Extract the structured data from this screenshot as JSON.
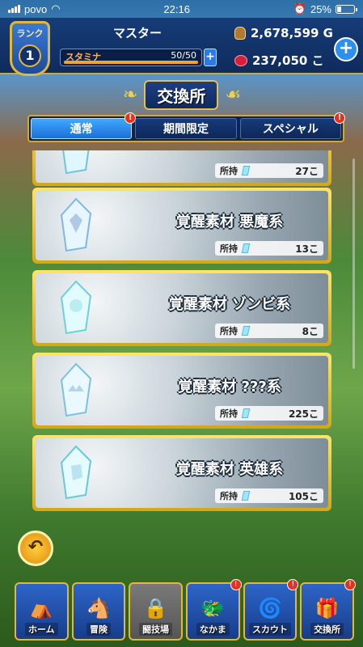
{
  "status_bar": {
    "carrier": "povo",
    "time": "22:16",
    "battery": "25%",
    "battery_level": 0.25
  },
  "header": {
    "rank_label": "ランク",
    "rank_value": "1",
    "player_name": "マスター",
    "stamina_label": "スタミナ",
    "stamina_text": "50/50",
    "stamina_fraction": 1.0,
    "gold": "2,678,599 G",
    "gems": "237,050 こ"
  },
  "title": "交換所",
  "tabs": [
    {
      "label": "通常",
      "active": true,
      "alert": "!"
    },
    {
      "label": "期間限定",
      "active": false,
      "alert": ""
    },
    {
      "label": "スペシャル",
      "active": false,
      "alert": "!"
    }
  ],
  "owned_label": "所持",
  "items": [
    {
      "name": "",
      "count": "27こ"
    },
    {
      "name": "覚醒素材 悪魔系",
      "count": "13こ"
    },
    {
      "name": "覚醒素材 ゾンビ系",
      "count": "8こ"
    },
    {
      "name": "覚醒素材 ???系",
      "count": "225こ"
    },
    {
      "name": "覚醒素材 英雄系",
      "count": "105こ"
    }
  ],
  "bottom_nav": [
    {
      "label": "ホーム",
      "icon": "tent-icon",
      "glyph": "⛺",
      "alert": ""
    },
    {
      "label": "冒険",
      "icon": "wagon-icon",
      "glyph": "🐴",
      "alert": ""
    },
    {
      "label": "闘技場",
      "icon": "lock-icon",
      "glyph": "🔒",
      "alert": ""
    },
    {
      "label": "なかま",
      "icon": "monster-icon",
      "glyph": "🐲",
      "alert": "!"
    },
    {
      "label": "スカウト",
      "icon": "portal-icon",
      "glyph": "🌀",
      "alert": "!"
    },
    {
      "label": "交換所",
      "icon": "shop-icon",
      "glyph": "🎁",
      "alert": "!"
    }
  ]
}
